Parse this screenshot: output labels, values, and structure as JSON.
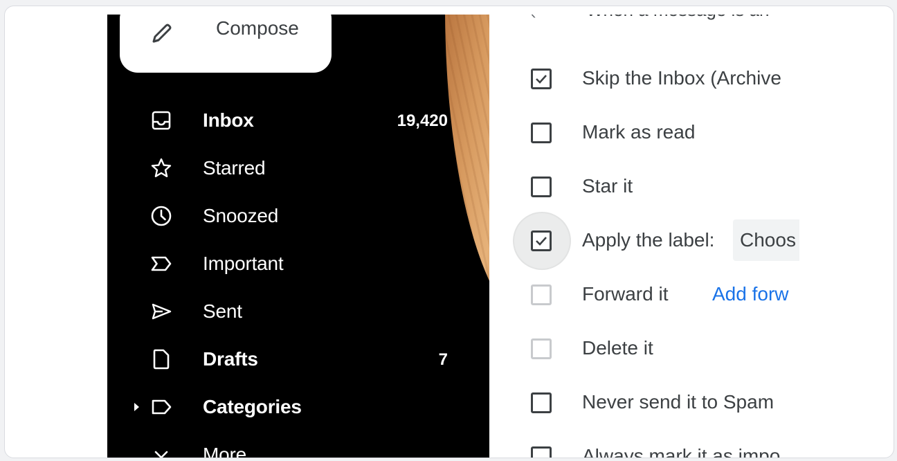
{
  "compose": {
    "label": "Compose",
    "icon": "pencil-icon"
  },
  "nav": [
    {
      "label": "Inbox",
      "count": "19,420",
      "icon": "inbox-icon",
      "bold": true
    },
    {
      "label": "Starred",
      "count": "",
      "icon": "star-icon",
      "bold": false
    },
    {
      "label": "Snoozed",
      "count": "",
      "icon": "clock-icon",
      "bold": false
    },
    {
      "label": "Important",
      "count": "",
      "icon": "important-icon",
      "bold": false
    },
    {
      "label": "Sent",
      "count": "",
      "icon": "send-icon",
      "bold": false
    },
    {
      "label": "Drafts",
      "count": "7",
      "icon": "draft-icon",
      "bold": true
    },
    {
      "label": "Categories",
      "count": "",
      "icon": "label-icon",
      "bold": true
    },
    {
      "label": "More",
      "count": "",
      "icon": "chevron-down-icon",
      "bold": false
    }
  ],
  "filter": {
    "cut_heading": "When a message is an",
    "options": [
      {
        "label": "Skip the Inbox (Archive",
        "checked": true
      },
      {
        "label": "Mark as read",
        "checked": false
      },
      {
        "label": "Star it",
        "checked": false
      },
      {
        "label": "Apply the label:",
        "checked": true,
        "select_value": "Choos"
      },
      {
        "label": "Forward it",
        "checked": false,
        "disabled": true,
        "link": "Add forw"
      },
      {
        "label": "Delete it",
        "checked": false,
        "disabled": true
      },
      {
        "label": "Never send it to Spam",
        "checked": false
      },
      {
        "label": "Always mark it as impo",
        "checked": false
      }
    ]
  },
  "colors": {
    "sidebar_bg": "#000000",
    "link": "#1a73e8",
    "text": "#3c4043"
  }
}
